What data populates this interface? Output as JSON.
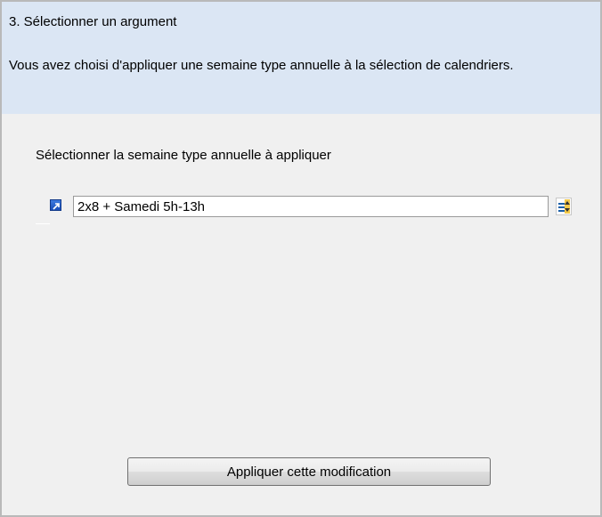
{
  "header": {
    "step_title": "3. Sélectionner un argument",
    "description": "Vous avez choisi d'appliquer une semaine type annuelle à la sélection de calendriers."
  },
  "form": {
    "prompt_label": "Sélectionner la semaine type annuelle à appliquer",
    "selected_value": "2x8 + Samedi 5h-13h",
    "link_icon": "shortcut-arrow-icon",
    "picker_icon": "list-picker-icon"
  },
  "actions": {
    "apply_label": "Appliquer cette modification"
  },
  "colors": {
    "header_background": "#dbe6f4",
    "panel_background": "#f0f0f0",
    "link_icon_blue": "#1a4fb8"
  }
}
